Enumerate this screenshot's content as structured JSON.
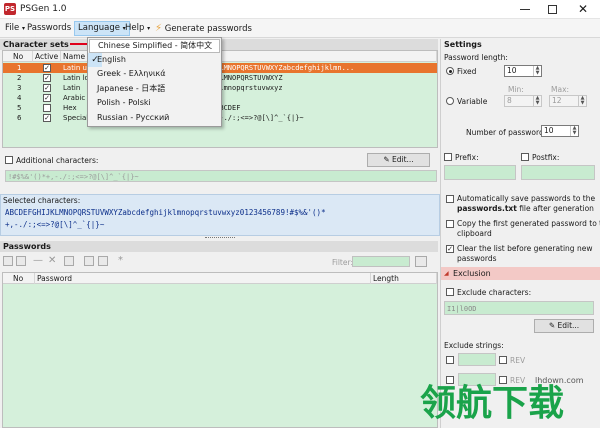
{
  "window": {
    "title": "PSGen 1.0",
    "icon_text": "PS"
  },
  "menu": {
    "file": "File",
    "passwords": "Passwords",
    "language": "Language",
    "help": "Help",
    "generate": "Generate passwords"
  },
  "language_menu": {
    "items": [
      "Chinese Simplified - 简体中文",
      "English",
      "Greek - Ελληνικά",
      "Japanese - 日本語",
      "Polish - Polski",
      "Russian - Русский"
    ],
    "checked": "✓"
  },
  "charsets": {
    "header": "Character sets",
    "columns": [
      "No",
      "Active",
      "Name",
      "Characters"
    ],
    "rows": [
      {
        "no": "1",
        "name": "Latin uppercase",
        "chars": "ABCDEFGHIJKLMNOPQRSTUVWXYZabcdefghijklmn..."
      },
      {
        "no": "2",
        "name": "Latin lowercase",
        "chars": "ABCDEFGHIJKLMNOPQRSTUVWXYZ"
      },
      {
        "no": "3",
        "name": "Latin",
        "chars": "abcdefghijklmnopqrstuvwxyz"
      },
      {
        "no": "4",
        "name": "Arabic digits",
        "chars": "0123456789"
      },
      {
        "no": "5",
        "name": "Hex",
        "chars": "0123456789ABCDEF"
      },
      {
        "no": "6",
        "name": "Special characters",
        "chars": "!#$%&'()*+,-./:;<=>?@[\\]^_`{|}~"
      }
    ]
  },
  "additional": {
    "label": "Additional characters:",
    "value": "!#$%&'()*+,-./:;<=>?@[\\]^_`{|}~",
    "edit": "Edit..."
  },
  "selected": {
    "label": "Selected characters:",
    "line1": "ABCDEFGHIJKLMNOPQRSTUVWXYZabcdefghijklmnopqrstuvwxyz0123456789!#$%&'()*",
    "line2": "+,-./:;<=>?@[\\]^_`{|}~"
  },
  "passwords": {
    "header": "Passwords",
    "filter_label": "Filter:",
    "columns": [
      "No",
      "Password",
      "Length"
    ]
  },
  "settings": {
    "header": "Settings",
    "length_label": "Password length:",
    "fixed": "Fixed",
    "fixed_value": "10",
    "variable": "Variable",
    "min_label": "Min:",
    "min_value": "8",
    "max_label": "Max:",
    "max_value": "12",
    "count_label": "Number of passwords:",
    "count_value": "10",
    "prefix": "Prefix:",
    "postfix": "Postfix:",
    "auto_save_1": "Automatically save passwords to the",
    "auto_save_2a": "passwords.txt",
    "auto_save_2b": " file after generation",
    "copy_first_1": "Copy the first generated password to the",
    "copy_first_2": "clipboard",
    "clear_list_1": "Clear the list before generating new",
    "clear_list_2": "passwords"
  },
  "exclusion": {
    "header": "Exclusion",
    "exclude_chars": "Exclude characters:",
    "exclude_value": "I1|l0OD",
    "edit": "Edit...",
    "exclude_strings": "Exclude strings:",
    "rev": "REV"
  },
  "watermark": {
    "site": "lhdown.com",
    "brand": "领航下载"
  },
  "colors": {
    "accent": "#e8742d",
    "green": "#c8ebd0",
    "exclusion": "#f3c9c6",
    "arrow": "#e0001a"
  }
}
